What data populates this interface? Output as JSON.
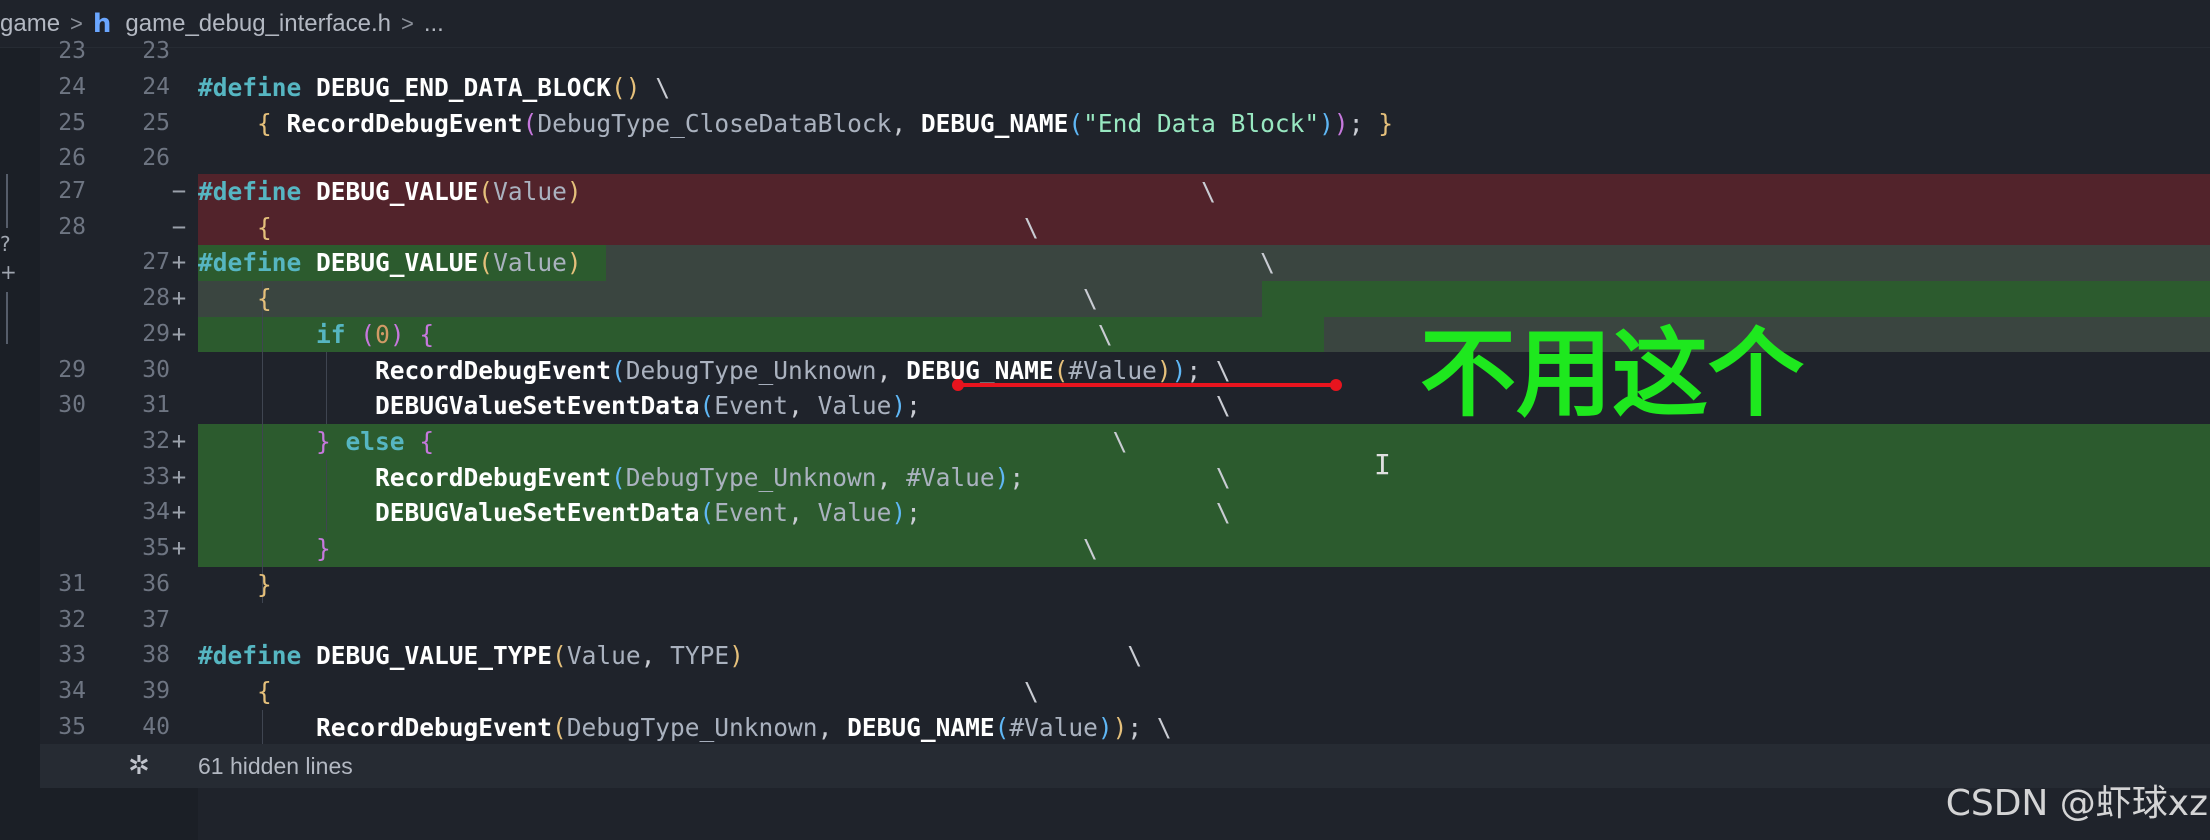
{
  "breadcrumb": {
    "folder": "game",
    "file_icon": "h",
    "file": "game_debug_interface.h",
    "ellipsis": "..."
  },
  "lines": [
    {
      "old": "23",
      "new": "23",
      "marker": ""
    },
    {
      "old": "24",
      "new": "24",
      "marker": ""
    },
    {
      "old": "25",
      "new": "25",
      "marker": ""
    },
    {
      "old": "26",
      "new": "26",
      "marker": ""
    },
    {
      "old": "27",
      "new": "",
      "marker": "−"
    },
    {
      "old": "28",
      "new": "",
      "marker": "−"
    },
    {
      "old": "",
      "new": "27",
      "marker": "+"
    },
    {
      "old": "",
      "new": "28",
      "marker": "+"
    },
    {
      "old": "",
      "new": "29",
      "marker": "+"
    },
    {
      "old": "29",
      "new": "30",
      "marker": ""
    },
    {
      "old": "30",
      "new": "31",
      "marker": ""
    },
    {
      "old": "",
      "new": "32",
      "marker": "+"
    },
    {
      "old": "",
      "new": "33",
      "marker": "+"
    },
    {
      "old": "",
      "new": "34",
      "marker": "+"
    },
    {
      "old": "",
      "new": "35",
      "marker": "+"
    },
    {
      "old": "31",
      "new": "36",
      "marker": ""
    },
    {
      "old": "32",
      "new": "37",
      "marker": ""
    },
    {
      "old": "33",
      "new": "38",
      "marker": ""
    },
    {
      "old": "34",
      "new": "39",
      "marker": ""
    },
    {
      "old": "35",
      "new": "40",
      "marker": ""
    }
  ],
  "code": {
    "define": "#define",
    "if": "if",
    "else": "else",
    "end_block_macro": "DEBUG_END_DATA_BLOCK",
    "record_fn": "RecordDebugEvent",
    "close_type": "DebugType_CloseDataBlock",
    "debug_name": "DEBUG_NAME",
    "end_str": "\"End Data Block\"",
    "value_macro": "DEBUG_VALUE",
    "value_param": "Value",
    "zero": "0",
    "unknown_type": "DebugType_Unknown",
    "hash_value": "#Value",
    "set_event_fn": "DEBUGValueSetEventData",
    "event_arg": "Event",
    "value_type_macro": "DEBUG_VALUE_TYPE",
    "type_param": "TYPE",
    "backslash": "\\"
  },
  "hidden_lines": {
    "icon": "unfold-icon",
    "label": "61 hidden lines"
  },
  "annotation": {
    "text": "不用这个",
    "color": "#1ee81e",
    "underline_color": "#e8141e"
  },
  "watermark": "CSDN @虾球xz",
  "colors": {
    "deleted_bg": "#52232b",
    "added_bg": "#2c5b2e"
  }
}
